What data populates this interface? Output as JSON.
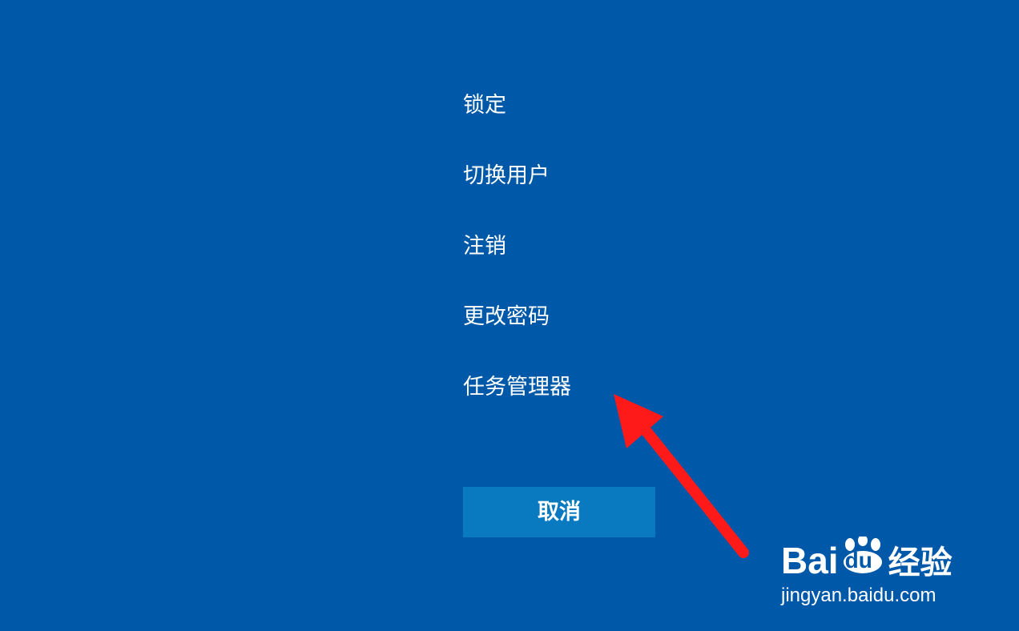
{
  "menu": {
    "items": [
      {
        "label": "锁定"
      },
      {
        "label": "切换用户"
      },
      {
        "label": "注销"
      },
      {
        "label": "更改密码"
      },
      {
        "label": "任务管理器"
      }
    ]
  },
  "cancel_label": "取消",
  "watermark": {
    "brand_prefix": "Bai",
    "brand_du": "du",
    "brand_suffix": "经验",
    "url": "jingyan.baidu.com"
  },
  "colors": {
    "background": "#0058a8",
    "button": "#0a7ac0",
    "arrow": "#ff1a1a"
  },
  "annotation": {
    "icon": "red-arrow-icon",
    "points_to": "任务管理器"
  }
}
